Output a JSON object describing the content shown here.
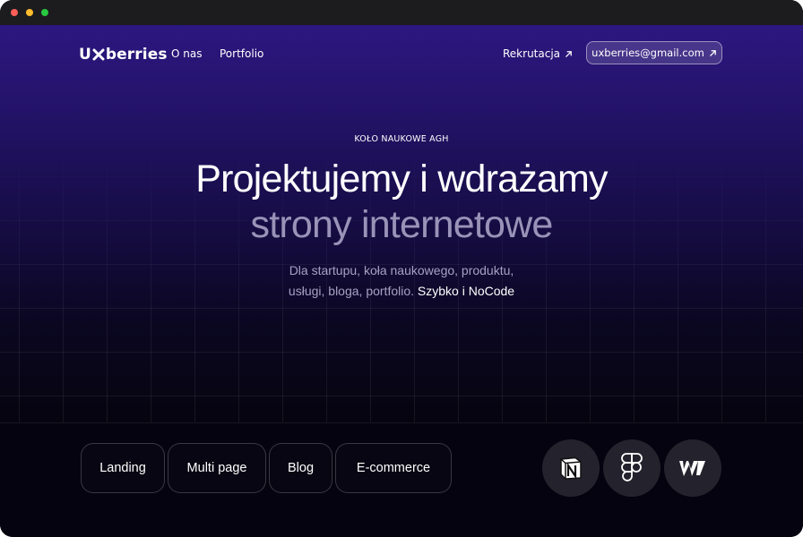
{
  "window": {
    "controls": [
      "close",
      "minimize",
      "maximize"
    ]
  },
  "nav": {
    "logo_prefix": "U",
    "logo_suffix": "berries",
    "links": [
      {
        "label": "O nas"
      },
      {
        "label": "Portfolio"
      }
    ],
    "rekrutacja_label": "Rekrutacja",
    "email_label": "uxberries@gmail.com"
  },
  "hero": {
    "eyebrow": "KOŁO NAUKOWE AGH",
    "headline_line1": "Projektujemy i wdrażamy",
    "headline_line2": "strony internetowe",
    "subtitle_line1": "Dla startupu, koła naukowego, produktu,",
    "subtitle_line2_prefix": "usługi, bloga, portfolio.",
    "subtitle_highlight": "Szybko i NoCode"
  },
  "services": [
    {
      "label": "Landing"
    },
    {
      "label": "Multi page"
    },
    {
      "label": "Blog"
    },
    {
      "label": "E-commerce"
    }
  ],
  "tools": [
    {
      "icon": "notion-icon"
    },
    {
      "icon": "figma-icon"
    },
    {
      "icon": "webflow-icon"
    }
  ],
  "colors": {
    "hero_top": "#2c1780",
    "background": "#04030f",
    "headline_muted": "#9a93b8",
    "tool_circle": "#24232d"
  }
}
